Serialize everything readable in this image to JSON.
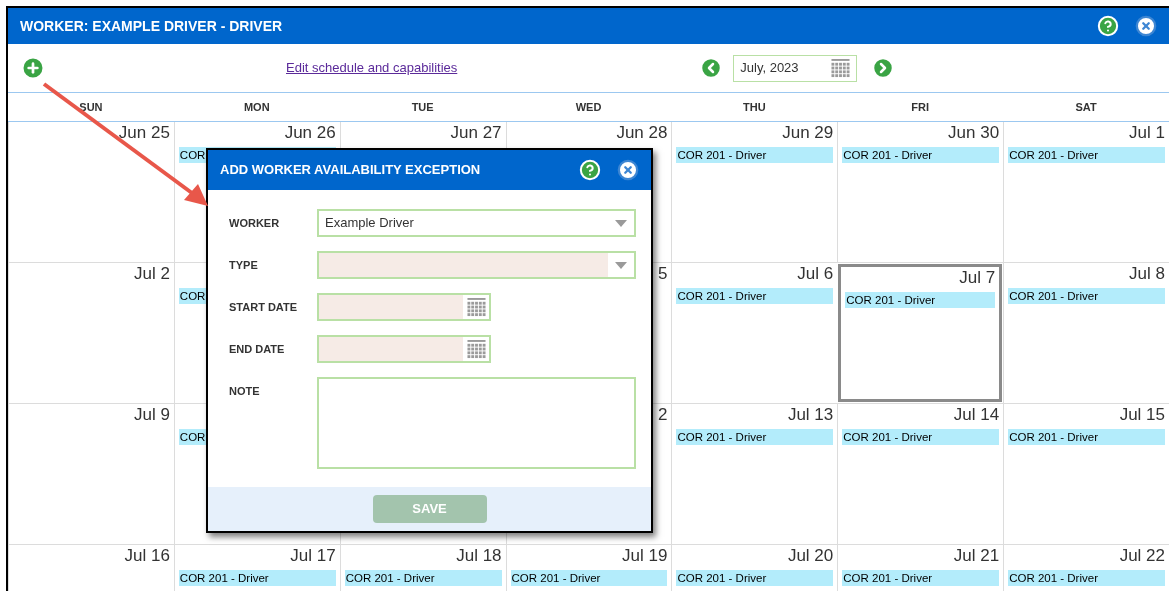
{
  "window": {
    "title": "WORKER: EXAMPLE DRIVER - DRIVER"
  },
  "toolbar": {
    "link": "Edit schedule and capabilities",
    "month_field": {
      "value": "July, 2023"
    }
  },
  "calendar": {
    "weekdays": [
      "SUN",
      "MON",
      "TUE",
      "WED",
      "THU",
      "FRI",
      "SAT"
    ],
    "weeks": [
      {
        "sun": {
          "date": "Jun 25",
          "selected": false
        },
        "mon": {
          "date": "Jun 26",
          "selected": false,
          "events": [
            "COR"
          ]
        },
        "tue": {
          "date": "Jun 27",
          "selected": false
        },
        "wed": {
          "date": "Jun 28",
          "selected": false
        },
        "thu": {
          "date": "Jun 29",
          "selected": false,
          "events": [
            "COR 201 - Driver"
          ]
        },
        "fri": {
          "date": "Jun 30",
          "selected": false,
          "events": [
            "COR 201 - Driver"
          ]
        },
        "sat": {
          "date": "Jul 1",
          "selected": false,
          "events": [
            "COR 201 - Driver"
          ]
        }
      },
      {
        "sun": {
          "date": "Jul 2",
          "selected": false
        },
        "mon": {
          "selected": false,
          "events": [
            "COR"
          ]
        },
        "wed": {
          "date": "5",
          "selected": false
        },
        "thu": {
          "date": "Jul 6",
          "selected": false,
          "events": [
            "COR 201 - Driver"
          ]
        },
        "fri": {
          "date": "Jul 7",
          "selected": true,
          "events": [
            "COR 201 - Driver"
          ]
        },
        "sat": {
          "date": "Jul 8",
          "selected": false,
          "events": [
            "COR 201 - Driver"
          ]
        }
      },
      {
        "sun": {
          "date": "Jul 9",
          "selected": false
        },
        "mon": {
          "selected": false,
          "events": [
            "COR"
          ]
        },
        "wed": {
          "date": "2",
          "selected": false
        },
        "thu": {
          "date": "Jul 13",
          "selected": false,
          "events": [
            "COR 201 - Driver"
          ]
        },
        "fri": {
          "date": "Jul 14",
          "selected": false,
          "events": [
            "COR 201 - Driver"
          ]
        },
        "sat": {
          "date": "Jul 15",
          "selected": false,
          "events": [
            "COR 201 - Driver"
          ]
        }
      },
      {
        "sun": {
          "date": "Jul 16",
          "selected": false
        },
        "mon": {
          "date": "Jul 17",
          "selected": false,
          "events": [
            "COR 201 - Driver"
          ]
        },
        "tue": {
          "date": "Jul 18",
          "selected": false,
          "events": [
            "COR 201 - Driver"
          ]
        },
        "wed": {
          "date": "Jul 19",
          "selected": false,
          "events": [
            "COR 201 - Driver"
          ]
        },
        "thu": {
          "date": "Jul 20",
          "selected": false,
          "events": [
            "COR 201 - Driver"
          ]
        },
        "fri": {
          "date": "Jul 21",
          "selected": false,
          "events": [
            "COR 201 - Driver"
          ]
        },
        "sat": {
          "date": "Jul 22",
          "selected": false,
          "events": [
            "COR 201 - Driver"
          ]
        }
      }
    ]
  },
  "dialog": {
    "title": "ADD WORKER AVAILABILITY EXCEPTION",
    "fields": [
      {
        "kind": "select",
        "label": "WORKER",
        "value": "Example Driver",
        "invalid": false
      },
      {
        "kind": "select",
        "label": "TYPE",
        "invalid": true
      },
      {
        "kind": "date",
        "label": "START DATE",
        "invalid": true
      },
      {
        "kind": "date",
        "label": "END DATE",
        "invalid": true
      },
      {
        "kind": "textarea",
        "label": "NOTE",
        "invalid": false
      }
    ],
    "save_button": {
      "label": "SAVE",
      "disabled": true
    }
  }
}
